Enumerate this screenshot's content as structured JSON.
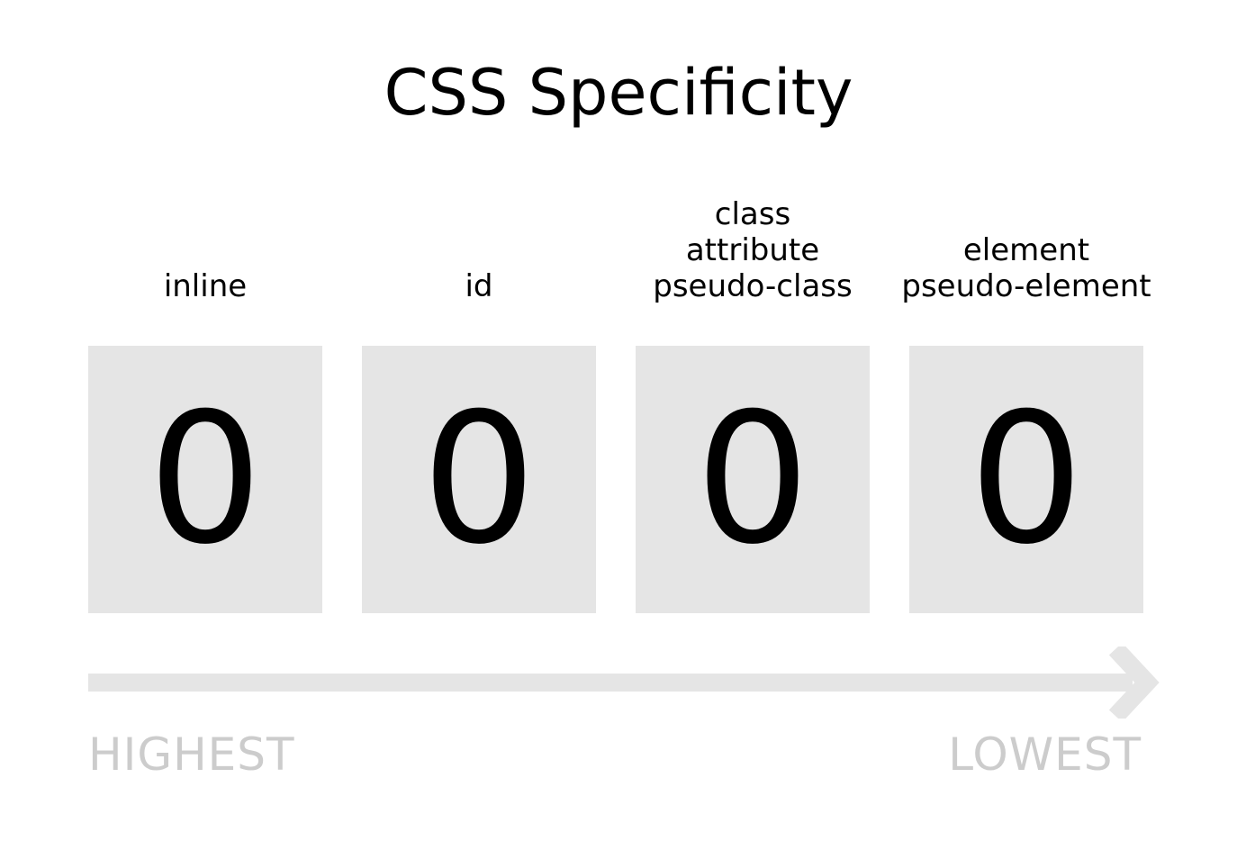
{
  "title": "CSS Specificity",
  "columns": [
    {
      "labels": [
        "inline"
      ],
      "value": "0"
    },
    {
      "labels": [
        "id"
      ],
      "value": "0"
    },
    {
      "labels": [
        "class",
        "attribute",
        "pseudo-class"
      ],
      "value": "0"
    },
    {
      "labels": [
        "element",
        "pseudo-element"
      ],
      "value": "0"
    }
  ],
  "scale": {
    "start_label": "HIGHEST",
    "end_label": "LOWEST"
  },
  "colors": {
    "box": "#e5e5e5",
    "arrow": "#e5e5e5",
    "scale_text": "#cccccc",
    "text": "#000000"
  }
}
